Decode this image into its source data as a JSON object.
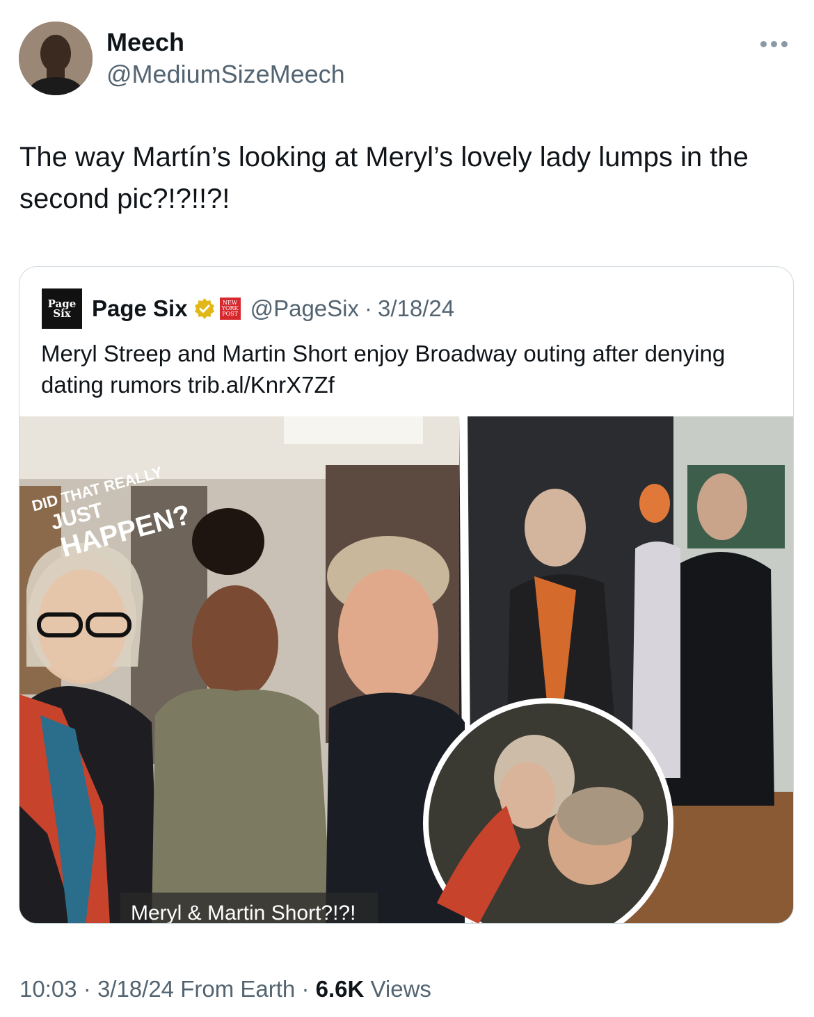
{
  "author": {
    "name": "Meech",
    "handle": "@MediumSizeMeech"
  },
  "tweet": {
    "text": "The way Martín’s looking at Meryl’s lovely lady lumps in the second pic?!?!!?!"
  },
  "quote": {
    "logo_top": "Page",
    "logo_bottom": "Six",
    "name": "Page Six",
    "affiliate_badge_line1": "NEW",
    "affiliate_badge_line2": "YORK",
    "affiliate_badge_line3": "POST",
    "handle": "@PageSix",
    "separator": "·",
    "date": "3/18/24",
    "text": "Meryl Streep and Martin Short enjoy Broadway outing after denying dating rumors trib.al/KnrX7Zf",
    "media": {
      "overlay_line1": "DID THAT REALLY",
      "overlay_line2": "JUST",
      "overlay_line3": "HAPPEN?",
      "caption": "Meryl & Martin Short?!?!"
    }
  },
  "meta": {
    "time": "10:03",
    "dot1": "·",
    "date": "3/18/24",
    "source": "From Earth",
    "dot2": "·",
    "views_count": "6.6K",
    "views_label": "Views"
  },
  "colors": {
    "text_primary": "#0f1419",
    "text_secondary": "#536471",
    "border": "#cfd9de",
    "verified_gold": "#e2b719",
    "nyp_red": "#d6282d"
  },
  "icons": [
    "more-icon",
    "verified-icon"
  ]
}
